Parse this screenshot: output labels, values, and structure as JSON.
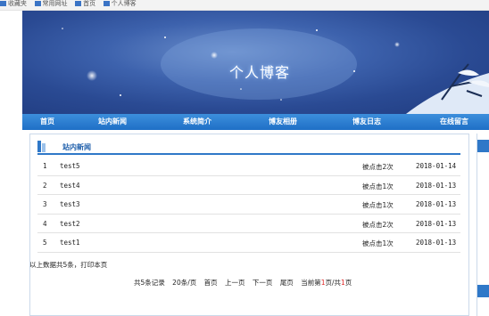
{
  "bookmarks": [
    "收藏夹",
    "常用网址",
    "首页",
    "个人博客"
  ],
  "banner": {
    "title": "个人博客"
  },
  "nav": [
    "首页",
    "站内新闻",
    "系统简介",
    "博友相册",
    "博友日志",
    "在线留言"
  ],
  "news": {
    "title": "站内新闻",
    "rows": [
      {
        "num": "1",
        "title": "test5",
        "hits": "被点击2次",
        "date": "2018-01-14"
      },
      {
        "num": "2",
        "title": "test4",
        "hits": "被点击1次",
        "date": "2018-01-13"
      },
      {
        "num": "3",
        "title": "test3",
        "hits": "被点击1次",
        "date": "2018-01-13"
      },
      {
        "num": "4",
        "title": "test2",
        "hits": "被点击2次",
        "date": "2018-01-13"
      },
      {
        "num": "5",
        "title": "test1",
        "hits": "被点击1次",
        "date": "2018-01-13"
      }
    ]
  },
  "summary": "以上数据共5条，打印本页",
  "pager": {
    "total": "共5条记录",
    "per_page": "20条/页",
    "first": "首页",
    "prev": "上一页",
    "next": "下一页",
    "last": "尾页",
    "current_prefix": "当前第",
    "current_page": "1",
    "current_mid": "页/共",
    "total_pages": "1",
    "current_suffix": "页"
  },
  "colors": {
    "nav": "#2a7ad0",
    "accent": "#2f78c8",
    "banner": "#2a4a93",
    "page_highlight": "#dd2222"
  }
}
